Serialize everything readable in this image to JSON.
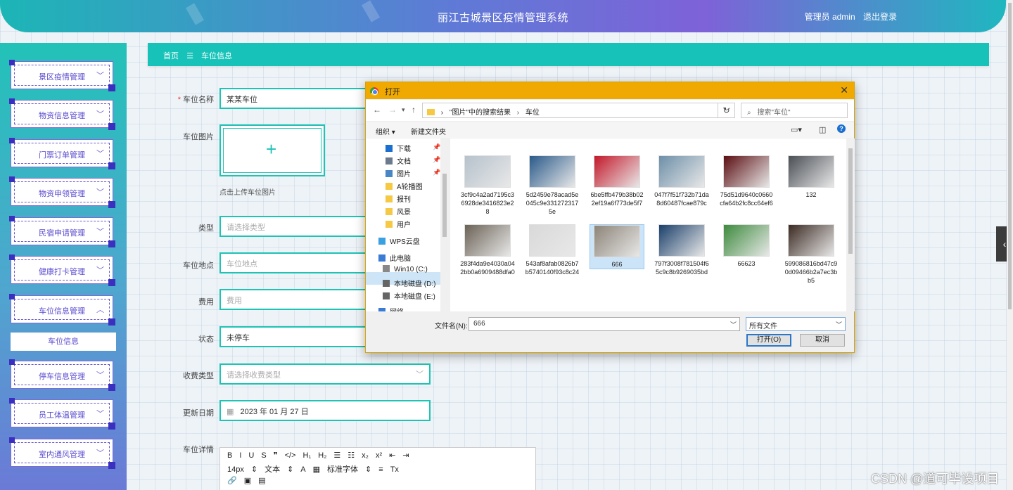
{
  "header": {
    "title": "丽江古城景区疫情管理系统",
    "user": "管理员 admin",
    "logout": "退出登录"
  },
  "sidebar": {
    "items": [
      {
        "label": "景区疫情管理",
        "chev": "﹀"
      },
      {
        "label": "物资信息管理",
        "chev": "﹀"
      },
      {
        "label": "门票订单管理",
        "chev": "﹀"
      },
      {
        "label": "物资申领管理",
        "chev": "﹀"
      },
      {
        "label": "民宿申请管理",
        "chev": "﹀"
      },
      {
        "label": "健康打卡管理",
        "chev": "﹀"
      },
      {
        "label": "车位信息管理",
        "chev": "︿"
      },
      {
        "label": "停车信息管理",
        "chev": "﹀"
      },
      {
        "label": "员工体温管理",
        "chev": "﹀"
      },
      {
        "label": "室内通风管理",
        "chev": "﹀"
      }
    ],
    "submenu": "车位信息"
  },
  "breadcrumb": {
    "home": "首页",
    "sep": "☰",
    "current": "车位信息"
  },
  "form": {
    "name_label": "车位名称",
    "name_value": "某某车位",
    "image_label": "车位图片",
    "upload_tip": "点击上传车位图片",
    "type_label": "类型",
    "type_placeholder": "请选择类型",
    "location_label": "车位地点",
    "location_placeholder": "车位地点",
    "fee_label": "费用",
    "fee_placeholder": "费用",
    "status_label": "状态",
    "status_value": "未停车",
    "charge_label": "收费类型",
    "charge_placeholder": "请选择收费类型",
    "date_label": "更新日期",
    "date_value": "2023 年 01 月 27 日",
    "detail_label": "车位详情"
  },
  "editor": {
    "row1": [
      "B",
      "I",
      "U",
      "S",
      "❞",
      "</>",
      "H₁",
      "H₂",
      "☰",
      "☷",
      "x₂",
      "x²",
      "⇤",
      "⇥"
    ],
    "row2": [
      "14px",
      "⇕",
      "文本",
      "⇕",
      "A",
      "▦",
      "标准字体",
      "⇕",
      "≡",
      "Tx"
    ],
    "row3": [
      "🔗",
      "▣",
      "▤"
    ]
  },
  "dialog": {
    "title": "打开",
    "path": [
      "\"图片\"中的搜索结果",
      "车位"
    ],
    "search_placeholder": "搜索\"车位\"",
    "organize": "组织 ▾",
    "new_folder": "新建文件夹",
    "nav": [
      {
        "label": "下载",
        "pinned": true
      },
      {
        "label": "文档",
        "pinned": true
      },
      {
        "label": "图片",
        "pinned": true
      },
      {
        "label": "A轮播图",
        "pinned": false
      },
      {
        "label": "报刊",
        "pinned": false
      },
      {
        "label": "风景",
        "pinned": false
      },
      {
        "label": "用户",
        "pinned": false
      },
      {
        "label": "WPS云盘",
        "pinned": false
      },
      {
        "label": "此电脑",
        "pinned": false
      },
      {
        "label": "Win10 (C:)",
        "pinned": false
      },
      {
        "label": "本地磁盘 (D:)",
        "pinned": false
      },
      {
        "label": "本地磁盘 (E:)",
        "pinned": false
      },
      {
        "label": "网络",
        "pinned": false
      }
    ],
    "files": [
      {
        "name": "3cf9c4a2ad7195c36928de3416823e28",
        "color": "#b6c2cc"
      },
      {
        "name": "5d2459e78acad5e045c9e3312723175e",
        "color": "#2a5a8a"
      },
      {
        "name": "6be5ffb479b38b022ef19a6f773de5f7",
        "color": "#c3182a"
      },
      {
        "name": "047f7f51f732b71da8d60487fcae879c",
        "color": "#6d8fa8"
      },
      {
        "name": "75d51d9640c0660cfa64b2fc8cc64ef6",
        "color": "#5b0e12"
      },
      {
        "name": "132",
        "color": "#4a4f55"
      },
      {
        "name": "283f4da9e4030a042bb0a6909488dfa0",
        "color": "#6b6256"
      },
      {
        "name": "543af8afab0826b7b5740140f93c8c24",
        "color": "#d9d9d9"
      },
      {
        "name": "666",
        "color": "#8c8478"
      },
      {
        "name": "797f3008f781504f65c9c8b9269035bd",
        "color": "#1a3f6a"
      },
      {
        "name": "66623",
        "color": "#3d8a3d"
      },
      {
        "name": "599086816bd47c90d09466b2a7ec3bb5",
        "color": "#3b2a22"
      }
    ],
    "filename_label": "文件名(N):",
    "filename_value": "666",
    "filetype": "所有文件",
    "open_button": "打开(O)",
    "cancel_button": "取消"
  },
  "watermark": "CSDN @道可毕设项目"
}
